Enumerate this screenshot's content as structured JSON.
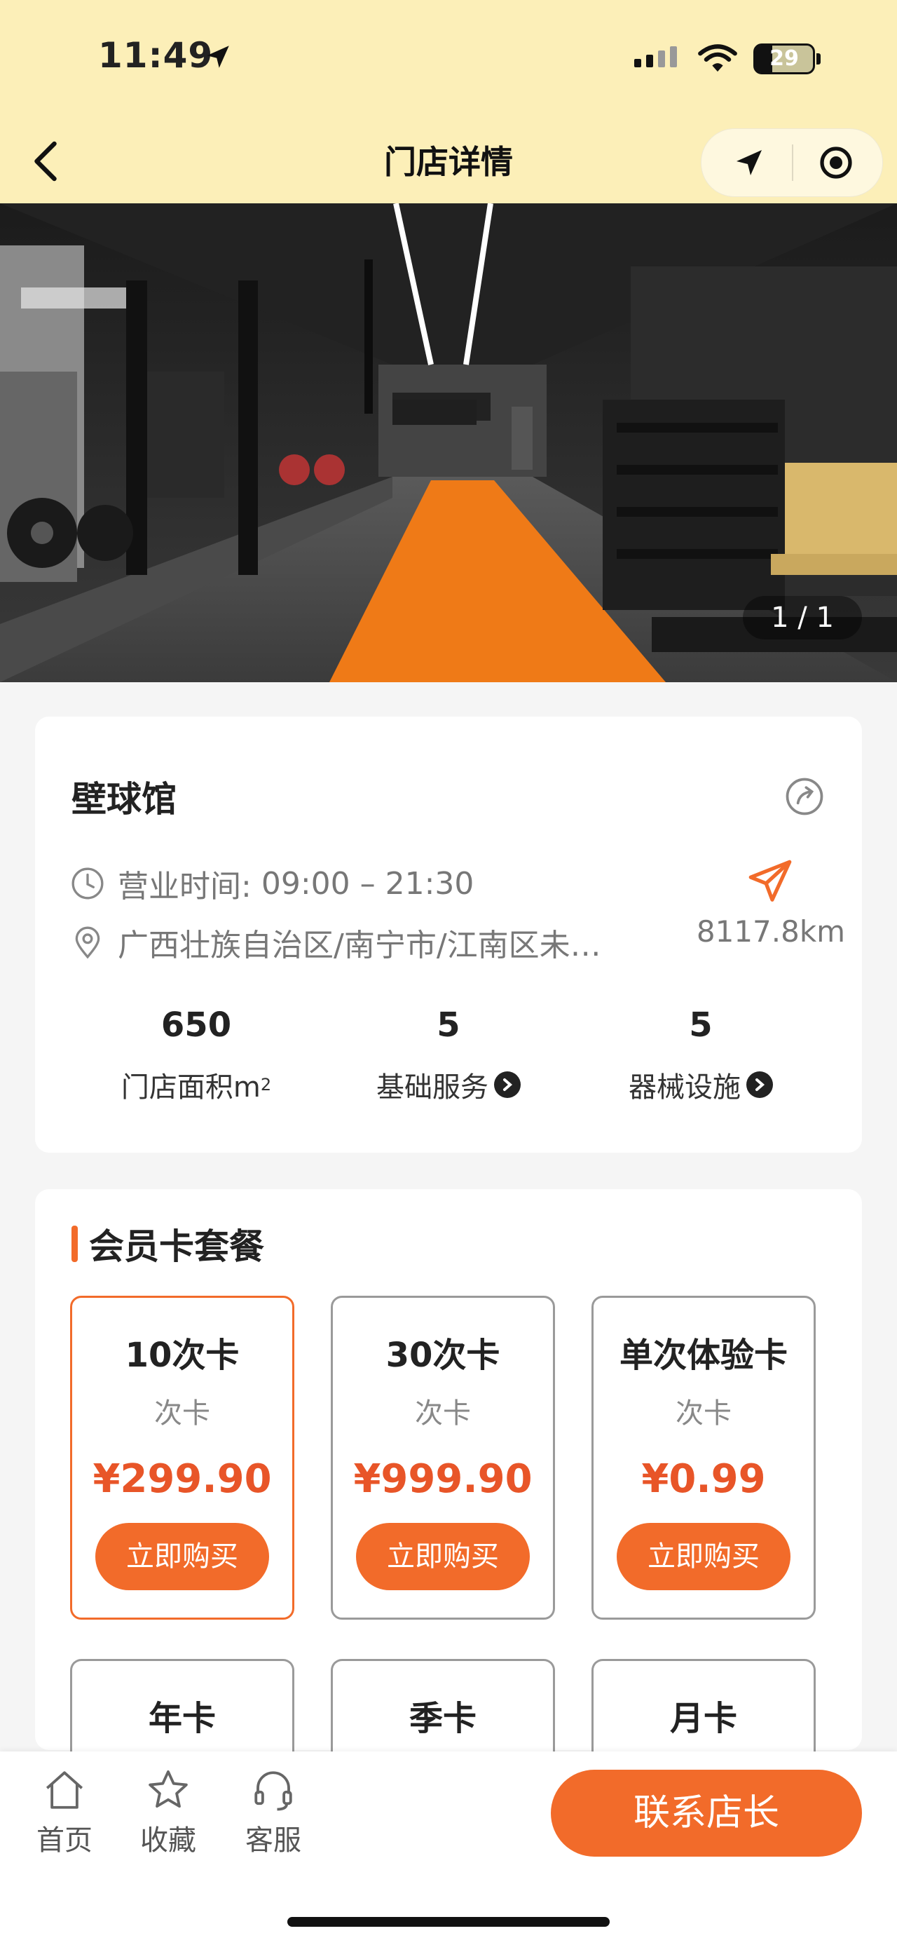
{
  "status_bar": {
    "time": "11:49",
    "battery": "29",
    "battery_level": 0.29
  },
  "nav": {
    "title": "门店详情"
  },
  "gallery": {
    "counter": "1 / 1"
  },
  "store": {
    "name": "壁球馆",
    "hours_label": "营业时间:",
    "hours": "09:00 – 21:30",
    "address": "广西壮族自治区/南宁市/江南区未…",
    "distance": "8117.8km",
    "stats": [
      {
        "value": "650",
        "label": "门店面积m",
        "sup": "2"
      },
      {
        "value": "5",
        "label": "基础服务"
      },
      {
        "value": "5",
        "label": "器械设施"
      }
    ]
  },
  "packages": {
    "title": "会员卡套餐",
    "items": [
      {
        "name": "10次卡",
        "type": "次卡",
        "price": "¥299.90",
        "button": "立即购买"
      },
      {
        "name": "30次卡",
        "type": "次卡",
        "price": "¥999.90",
        "button": "立即购买"
      },
      {
        "name": "单次体验卡",
        "type": "次卡",
        "price": "¥0.99",
        "button": "立即购买"
      }
    ],
    "more": [
      {
        "name": "年卡"
      },
      {
        "name": "季卡"
      },
      {
        "name": "月卡"
      }
    ]
  },
  "bottom_bar": {
    "tabs": [
      {
        "label": "首页",
        "icon": "home-icon"
      },
      {
        "label": "收藏",
        "icon": "star-icon"
      },
      {
        "label": "客服",
        "icon": "headset-icon"
      }
    ],
    "contact": "联系店长"
  },
  "colors": {
    "accent": "#f26b2a",
    "price": "#e85528",
    "header_bg": "#fcefb8"
  }
}
